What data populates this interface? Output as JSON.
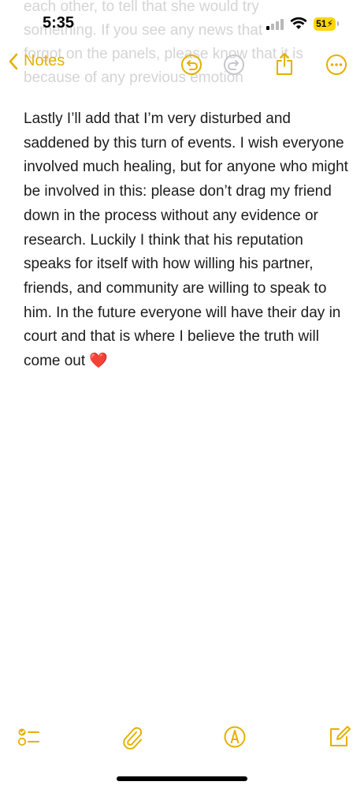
{
  "status_bar": {
    "time": "5:35",
    "battery_level": "51",
    "battery_charging": true,
    "signal_bars_active": 1,
    "signal_bars_total": 4
  },
  "nav": {
    "back_label": "Notes",
    "back_icon": "chevron-left-icon",
    "undo_icon": "undo-icon",
    "redo_icon": "redo-icon",
    "share_icon": "share-icon",
    "more_icon": "more-icon"
  },
  "faded_text": "each other, to tell that she would try\nsomething. If you see any news that\nforgot on the panels, please know that it is\nbecause of any previous emotion",
  "note": {
    "body": "Lastly I’ll add that I’m very disturbed and saddened by this turn of events. I wish everyone involved much healing, but for anyone who might be involved in this: please don’t drag my friend down in the process without any evidence or research. Luckily I think that his reputation speaks for itself with how willing his partner, friends, and community are willing to speak to him. In the future everyone will have their day in court and that is where I believe the truth will come out ❤️"
  },
  "toolbar": {
    "checklist_icon": "checklist-icon",
    "attachment_icon": "paperclip-icon",
    "markup_icon": "markup-pen-icon",
    "compose_icon": "compose-icon"
  },
  "colors": {
    "accent": "#e5b000",
    "text": "#1c1c1e",
    "faded_text": "#d4d4d4",
    "battery": "#ffd60a",
    "disabled_icon": "#c7c7cc"
  }
}
